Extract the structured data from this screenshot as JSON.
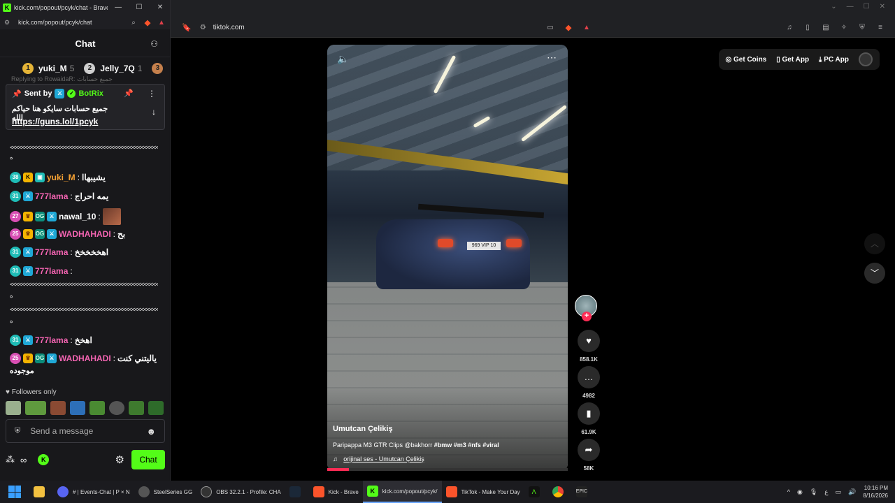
{
  "kick": {
    "window_title": "kick.com/popout/pcyk/chat - Brave",
    "url": "kick.com/popout/pcyk/chat",
    "chat_title": "Chat",
    "leaderboard": [
      {
        "rank": "1",
        "name": "yuki_M",
        "count": "5"
      },
      {
        "rank": "2",
        "name": "Jelly_7Q",
        "count": "1"
      },
      {
        "rank": "3",
        "name": "",
        "count": ""
      }
    ],
    "reply_hint": "Replying to RowaidaR: جميع حسابات",
    "pinned": {
      "sent_by_label": "Sent by",
      "sender": "BotRix",
      "message": "جميع حسابات سايكو هنا حياكم الله",
      "link": "https://guns.lol/1pcyk"
    },
    "messages": [
      {
        "spam": "<<<<<<<<<<<<<<<<<<<<<<<<<<<<<<<<<<<<<<<<<<<<<<<<<<<<<<",
        "tail": "ه"
      },
      {
        "badge": "38",
        "user": "yuki_M",
        "text": "يشيبهاا"
      },
      {
        "badge": "31",
        "user": "777lama",
        "text": "يمه احراج"
      },
      {
        "badge": "27",
        "user": "nawal_10",
        "text": ""
      },
      {
        "badge": "25",
        "user": "WADHAHADI",
        "text": "بح"
      },
      {
        "badge": "31",
        "user": "777lama",
        "text": "اهخخخخخ"
      },
      {
        "badge": "31",
        "user": "777lama",
        "text": ""
      },
      {
        "spam": "<<<<<<<<<<<<<<<<<<<<<<<<<<<<<<<<<<<<<<<<<<<<<<<<<<<<<<",
        "tail": "ه"
      },
      {
        "spam": "<<<<<<<<<<<<<<<<<<<<<<<<<<<<<<<<<<<<<<<<<<<<<<<<<<<<<<",
        "tail": "ه"
      },
      {
        "badge": "31",
        "user": "777lama",
        "text": "اهخخ"
      },
      {
        "badge": "25",
        "user": "WADHAHADI",
        "text": "ياليتني كنت",
        "tail": "موجوده"
      }
    ],
    "followers_only": "Followers only",
    "input_placeholder": "Send a message",
    "chat_button": "Chat"
  },
  "tiktok": {
    "url": "tiktok.com",
    "nav": {
      "coins": "Get Coins",
      "app": "Get App",
      "pc": "PC App"
    },
    "video": {
      "author": "Umutcan Çelikiş",
      "description_plain": "Paripappa M3 GTR Clips @bakhorr ",
      "hashtags": "#bmw #m3 #nfs #viral",
      "music": "orijinal ses - Umutcan Çelikiş",
      "plate": "969 VIP 10",
      "progress": 0.09
    },
    "actions": {
      "likes": "858.1K",
      "comments": "4982",
      "saves": "61.9K",
      "shares": "58K"
    }
  },
  "taskbar": {
    "items": [
      {
        "label": "# | Events-Chat | P × N",
        "icon_color": "#5865f2",
        "badge": "6"
      },
      {
        "label": "SteelSeries GG",
        "icon_color": "#444"
      },
      {
        "label": "OBS 32.2.1 - Profile: CHA",
        "icon_color": "#333"
      },
      {
        "label": "",
        "icon_color": "#1b2838"
      },
      {
        "label": "Kick - Brave",
        "icon_color": "#fb542b"
      },
      {
        "label": "kick.com/popout/pcyk/",
        "icon_color": "#53fc18",
        "active": true
      },
      {
        "label": "TikTok - Make Your Day",
        "icon_color": "#fb542b"
      }
    ],
    "time": "10:16 PM",
    "date": "8/16/2026",
    "lang": "ع"
  }
}
